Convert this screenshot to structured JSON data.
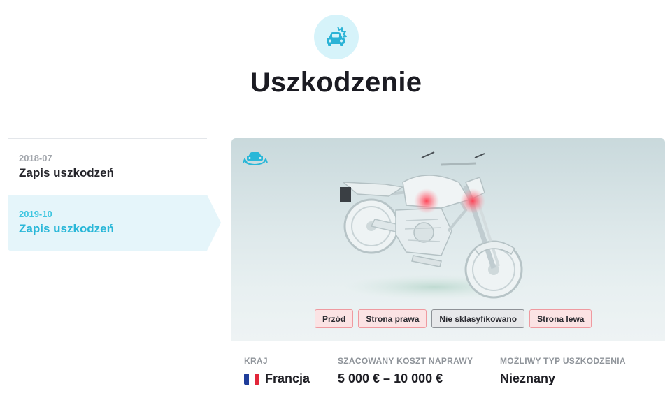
{
  "header": {
    "icon": "car-damage-icon",
    "title": "Uszkodzenie"
  },
  "timeline": {
    "items": [
      {
        "date": "2018-07",
        "label": "Zapis uszkodzeń",
        "active": false
      },
      {
        "date": "2019-10",
        "label": "Zapis uszkodzeń",
        "active": true
      }
    ]
  },
  "viewer": {
    "rotate_icon": "rotate-vehicle-icon",
    "zones": [
      {
        "label": "Przód",
        "state": "damaged"
      },
      {
        "label": "Strona prawa",
        "state": "damaged"
      },
      {
        "label": "Nie sklasyfikowano",
        "state": "unclassified"
      },
      {
        "label": "Strona lewa",
        "state": "damaged"
      }
    ]
  },
  "info": {
    "country": {
      "caption": "KRAJ",
      "value": "Francja",
      "flag": "fr-flag-icon"
    },
    "repair_cost": {
      "caption": "SZACOWANY KOSZT NAPRAWY",
      "value": "5 000 € – 10 000 €"
    },
    "damage_type": {
      "caption": "MOŻLIWY TYP USZKODZENIA",
      "value": "Nieznany"
    }
  },
  "colors": {
    "accent": "#29b7d8",
    "accent_light": "#e5f5fa",
    "damage_red": "#ef9aa0",
    "damage_bg": "#fbe3e4"
  }
}
